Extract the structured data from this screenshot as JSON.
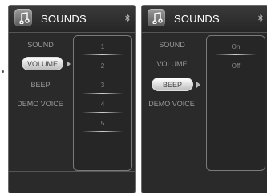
{
  "left_screen": {
    "title": "SOUNDS",
    "menu": [
      "SOUND",
      "VOLUME",
      "BEEP",
      "DEMO VOICE"
    ],
    "selected_menu": "VOLUME",
    "options": [
      "1",
      "2",
      "3",
      "4",
      "5"
    ]
  },
  "right_screen": {
    "title": "SOUNDS",
    "menu": [
      "SOUND",
      "VOLUME",
      "BEEP",
      "DEMO VOICE"
    ],
    "selected_menu": "BEEP",
    "options": [
      "On",
      "Off"
    ]
  },
  "icons": {
    "app": "music-note-icon",
    "bluetooth": "bluetooth-icon",
    "selection_arrow": "arrow-right-icon"
  },
  "colors": {
    "screen_bg": "#2a2a2a",
    "title_text": "#ffffff",
    "menu_text": "#9a9a9a",
    "selected_pill": "#e6e6e6"
  }
}
